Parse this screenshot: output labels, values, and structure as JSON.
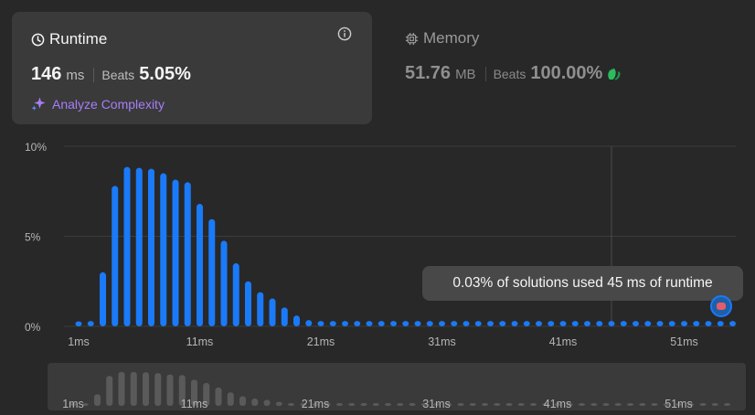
{
  "runtime": {
    "title": "Runtime",
    "value": "146",
    "unit": "ms",
    "beats_label": "Beats",
    "beats_value": "5.05%",
    "analyze_label": "Analyze Complexity"
  },
  "memory": {
    "title": "Memory",
    "value": "51.76",
    "unit": "MB",
    "beats_label": "Beats",
    "beats_value": "100.00%"
  },
  "tooltip": {
    "text": "0.03% of solutions used 45 ms of runtime"
  },
  "colors": {
    "bar": "#1a7af8",
    "minimap_bar": "#5a5a5a",
    "accent_purple": "#a67ef8",
    "hand": "#2cbb5d"
  },
  "chart_data": {
    "type": "bar",
    "yticks": [
      "10%",
      "5%",
      "0%"
    ],
    "ylim": [
      0,
      10
    ],
    "xtick_labels": [
      "1ms",
      "11ms",
      "21ms",
      "31ms",
      "41ms",
      "51ms"
    ],
    "x_start": 1,
    "x_step": 1,
    "selected_x": 45,
    "values": [
      0.28,
      0.3,
      3.0,
      7.8,
      8.85,
      8.8,
      8.75,
      8.5,
      8.15,
      8.0,
      6.8,
      5.95,
      4.75,
      3.5,
      2.5,
      1.9,
      1.55,
      1.05,
      0.6,
      0.35,
      0.3,
      0.3,
      0.3,
      0.3,
      0.3,
      0.3,
      0.3,
      0.3,
      0.3,
      0.3,
      0.3,
      0.3,
      0.3,
      0.3,
      0.3,
      0.3,
      0.3,
      0.3,
      0.3,
      0.3,
      0.3,
      0.3,
      0.3,
      0.3,
      0.3,
      0.3,
      0.3,
      0.3,
      0.3,
      0.3,
      0.3,
      0.3,
      0.3,
      0.3,
      0.3
    ]
  }
}
